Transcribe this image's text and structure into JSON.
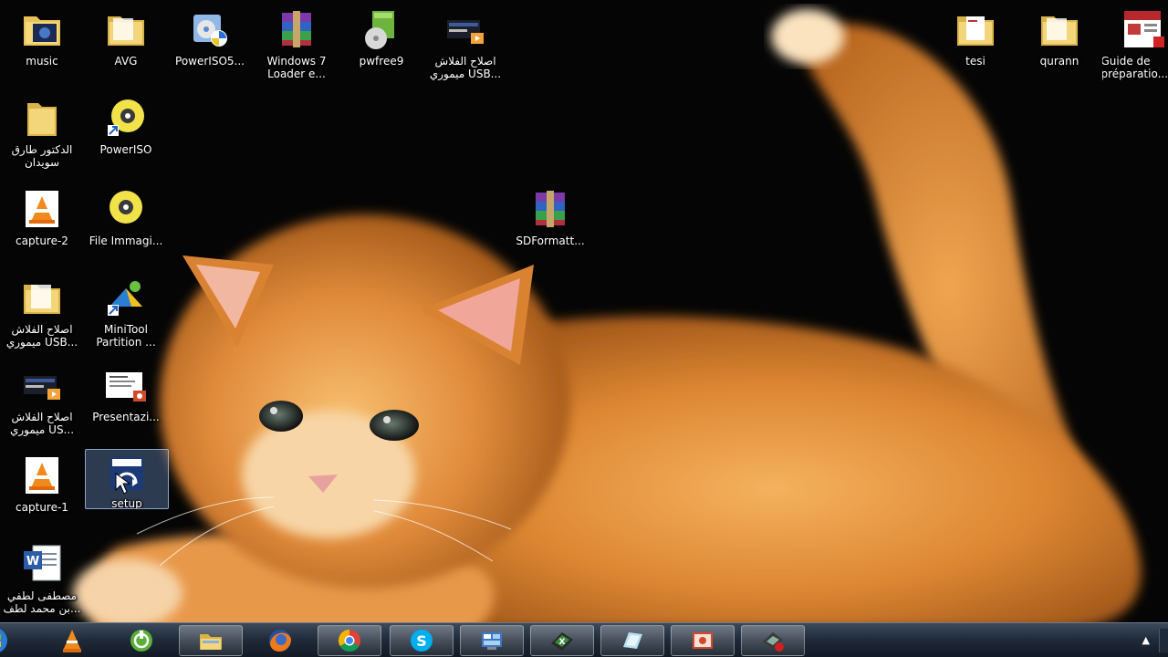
{
  "desktop": {
    "icons": [
      {
        "label": "music",
        "icon": "media-folder-icon"
      },
      {
        "label": "AVG",
        "icon": "folder-icon"
      },
      {
        "label": "PowerISO5...",
        "icon": "installer-icon"
      },
      {
        "label": "Windows 7 Loader e...",
        "icon": "winrar-archive-icon"
      },
      {
        "label": "pwfree9",
        "icon": "disc-box-icon"
      },
      {
        "label": "اصلاح الفلاش ميموري USB...",
        "icon": "video-file-icon"
      },
      {
        "label": "tesi",
        "icon": "folder-icon"
      },
      {
        "label": "qurann",
        "icon": "folder-icon"
      },
      {
        "label": "Guide de préparatio...",
        "icon": "pdf-document-icon"
      },
      {
        "label": "الدكتور طارق سويدان",
        "icon": "folder-icon"
      },
      {
        "label": "PowerISO",
        "icon": "poweriso-disc-icon"
      },
      {
        "label": "capture-2",
        "icon": "vlc-icon"
      },
      {
        "label": "File Immagi...",
        "icon": "disc-image-icon"
      },
      {
        "label": "SDFormatt...",
        "icon": "winrar-archive-icon"
      },
      {
        "label": "اصلاح الفلاش ميموري USB...",
        "icon": "folder-icon"
      },
      {
        "label": "MiniTool Partition ...",
        "icon": "minitool-icon"
      },
      {
        "label": "اصلاح الفلاش ميموري US...",
        "icon": "video-file-icon"
      },
      {
        "label": "Presentazi...",
        "icon": "presentation-icon"
      },
      {
        "label": "capture-1",
        "icon": "vlc-icon"
      },
      {
        "label": "setup",
        "icon": "setup-icon"
      },
      {
        "label": "مصطفى لطفي بن محمد لطف...",
        "icon": "word-document-icon"
      }
    ]
  },
  "taskbar": {
    "items": [
      {
        "name": "start-button",
        "icon": "windows-orb-icon"
      },
      {
        "name": "vlc",
        "icon": "vlc-icon"
      },
      {
        "name": "utility",
        "icon": "green-circle-icon"
      },
      {
        "name": "explorer",
        "icon": "folder-icon"
      },
      {
        "name": "firefox",
        "icon": "firefox-icon"
      },
      {
        "name": "chrome",
        "icon": "chrome-icon"
      },
      {
        "name": "skype",
        "icon": "skype-icon"
      },
      {
        "name": "control-panel",
        "icon": "control-panel-icon"
      },
      {
        "name": "excel",
        "icon": "spreadsheet-icon"
      },
      {
        "name": "notes",
        "icon": "notes-icon"
      },
      {
        "name": "powerpoint",
        "icon": "presentation-icon"
      },
      {
        "name": "recorder",
        "icon": "recorder-icon"
      }
    ],
    "tray_arrow": "▲"
  },
  "colors": {
    "taskbar": "#1f2a38",
    "wallpaper_bg": "#050505",
    "kitten_fur": "#e08a3a",
    "selection": "#7aa0dc"
  }
}
